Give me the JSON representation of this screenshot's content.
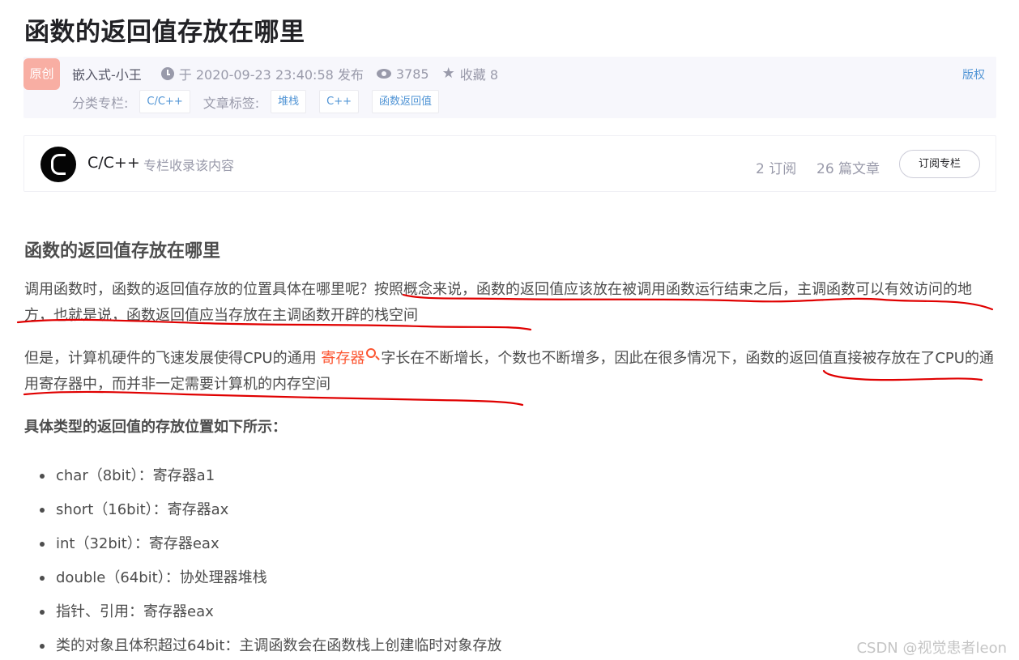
{
  "article": {
    "title": "函数的返回值存放在哪里",
    "badge": "原创",
    "author": "嵌入式-小王",
    "published": "于 2020-09-23 23:40:58 发布",
    "views": "3785",
    "favorites": "收藏 8",
    "copyright": "版权",
    "category_label": "分类专栏:",
    "categories": [
      "C/C++"
    ],
    "tag_label": "文章标签:",
    "tags": [
      "堆栈",
      "C++",
      "函数返回值"
    ]
  },
  "column": {
    "name": "C/C++",
    "desc": "专栏收录该内容",
    "subscribers": "2 订阅",
    "articles": "26 篇文章",
    "subscribe_button": "订阅专栏"
  },
  "content": {
    "heading": "函数的返回值存放在哪里",
    "p1": "调用函数时，函数的返回值存放的位置具体在哪里呢？按照概念来说，函数的返回值应该放在被调用函数运行结束之后，主调函数可以有效访问的地方，也就是说，函数返回值应当存放在主调函数开辟的栈空间",
    "p2_before": "但是，计算机硬件的飞速发展使得CPU的通用 ",
    "p2_link": "寄存器",
    "p2_after": "字长在不断增长，个数也不断增多，因此在很多情况下，函数的返回值直接被存放在了CPU的通用寄存器中，而并非一定需要计算机的内存空间",
    "subheading": "具体类型的返回值的存放位置如下所示：",
    "items": [
      "char（8bit）：寄存器a1",
      "short（16bit）：寄存器ax",
      "int（32bit）：寄存器eax",
      "double（64bit）：协处理器堆栈",
      "指针、引用：寄存器eax",
      "类的对象且体积超过64bit：主调函数会在函数栈上创建临时对象存放"
    ]
  },
  "annotation_color": "#e00000",
  "watermark": "CSDN @视觉患者leon"
}
